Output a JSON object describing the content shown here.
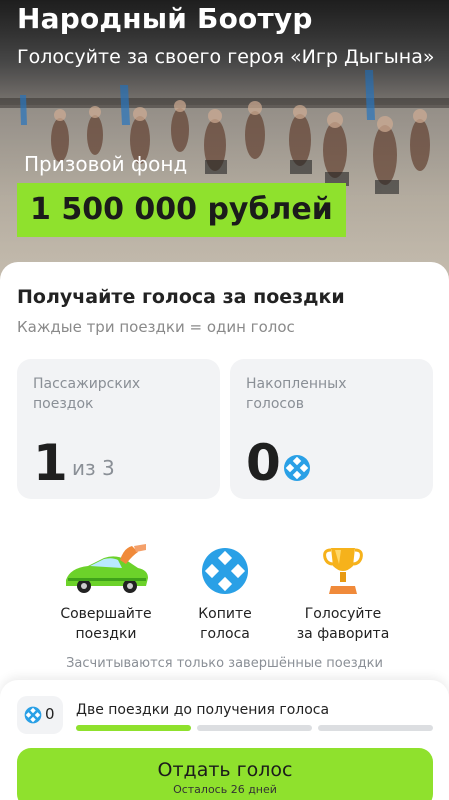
{
  "hero": {
    "title": "Народный Боотур",
    "subtitle": "Голосуйте за своего героя «Игр Дыгына»",
    "prize_label": "Призовой фонд",
    "prize_amount": "1 500 000 рублей"
  },
  "main": {
    "title": "Получайте голоса за поездки",
    "subtitle": "Каждые три поездки = один голос",
    "cards": [
      {
        "label": "Пассажирских поездок",
        "value": "1",
        "suffix": "из 3"
      },
      {
        "label": "Накопленных голосов",
        "value": "0",
        "icon": "vote-token-icon"
      }
    ],
    "steps": [
      {
        "icon": "taxi-car-icon",
        "line1": "Совершайте",
        "line2": "поездки"
      },
      {
        "icon": "vote-token-icon",
        "line1": "Копите",
        "line2": "голоса"
      },
      {
        "icon": "trophy-icon",
        "line1": "Голосуйте",
        "line2": "за фаворита"
      }
    ],
    "note": "Засчитываются только завершённые поездки"
  },
  "bottom": {
    "votes_count": "0",
    "progress_label": "Две поездки до получения голоса",
    "progress_segments": [
      1,
      0,
      0
    ],
    "vote_button_label": "Отдать голос",
    "vote_button_sub": "Осталось 26 дней"
  },
  "colors": {
    "accent_green": "#8fe12d",
    "token_blue": "#2aa0e6"
  }
}
